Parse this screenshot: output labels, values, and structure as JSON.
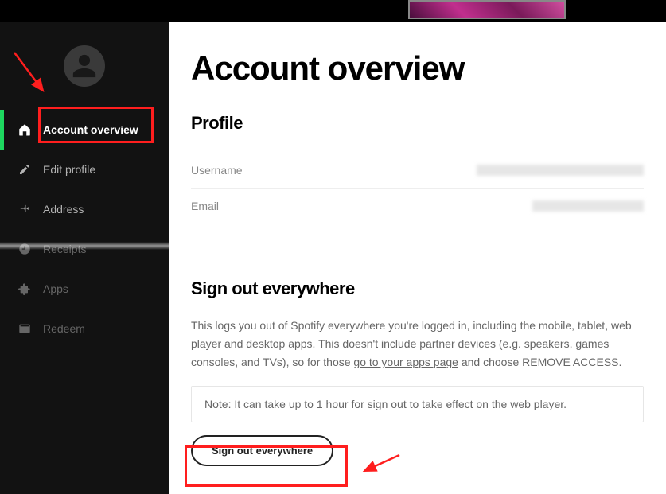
{
  "page": {
    "title": "Account overview"
  },
  "sidebar": {
    "items": [
      {
        "label": "Account overview"
      },
      {
        "label": "Edit profile"
      },
      {
        "label": "Address"
      },
      {
        "label": "Receipts"
      },
      {
        "label": "Apps"
      },
      {
        "label": "Redeem"
      }
    ]
  },
  "profile": {
    "heading": "Profile",
    "rows": [
      {
        "label": "Username"
      },
      {
        "label": "Email"
      }
    ]
  },
  "signout": {
    "heading": "Sign out everywhere",
    "desc_prefix": "This logs you out of Spotify everywhere you're logged in, including the mobile, tablet, web player and desktop apps. This doesn't include partner devices (e.g. speakers, games consoles, and TVs), so for those ",
    "desc_link": "go to your apps page",
    "desc_suffix": " and choose REMOVE ACCESS.",
    "note": "Note: It can take up to 1 hour for sign out to take effect on the web player.",
    "button": "Sign out everywhere"
  }
}
